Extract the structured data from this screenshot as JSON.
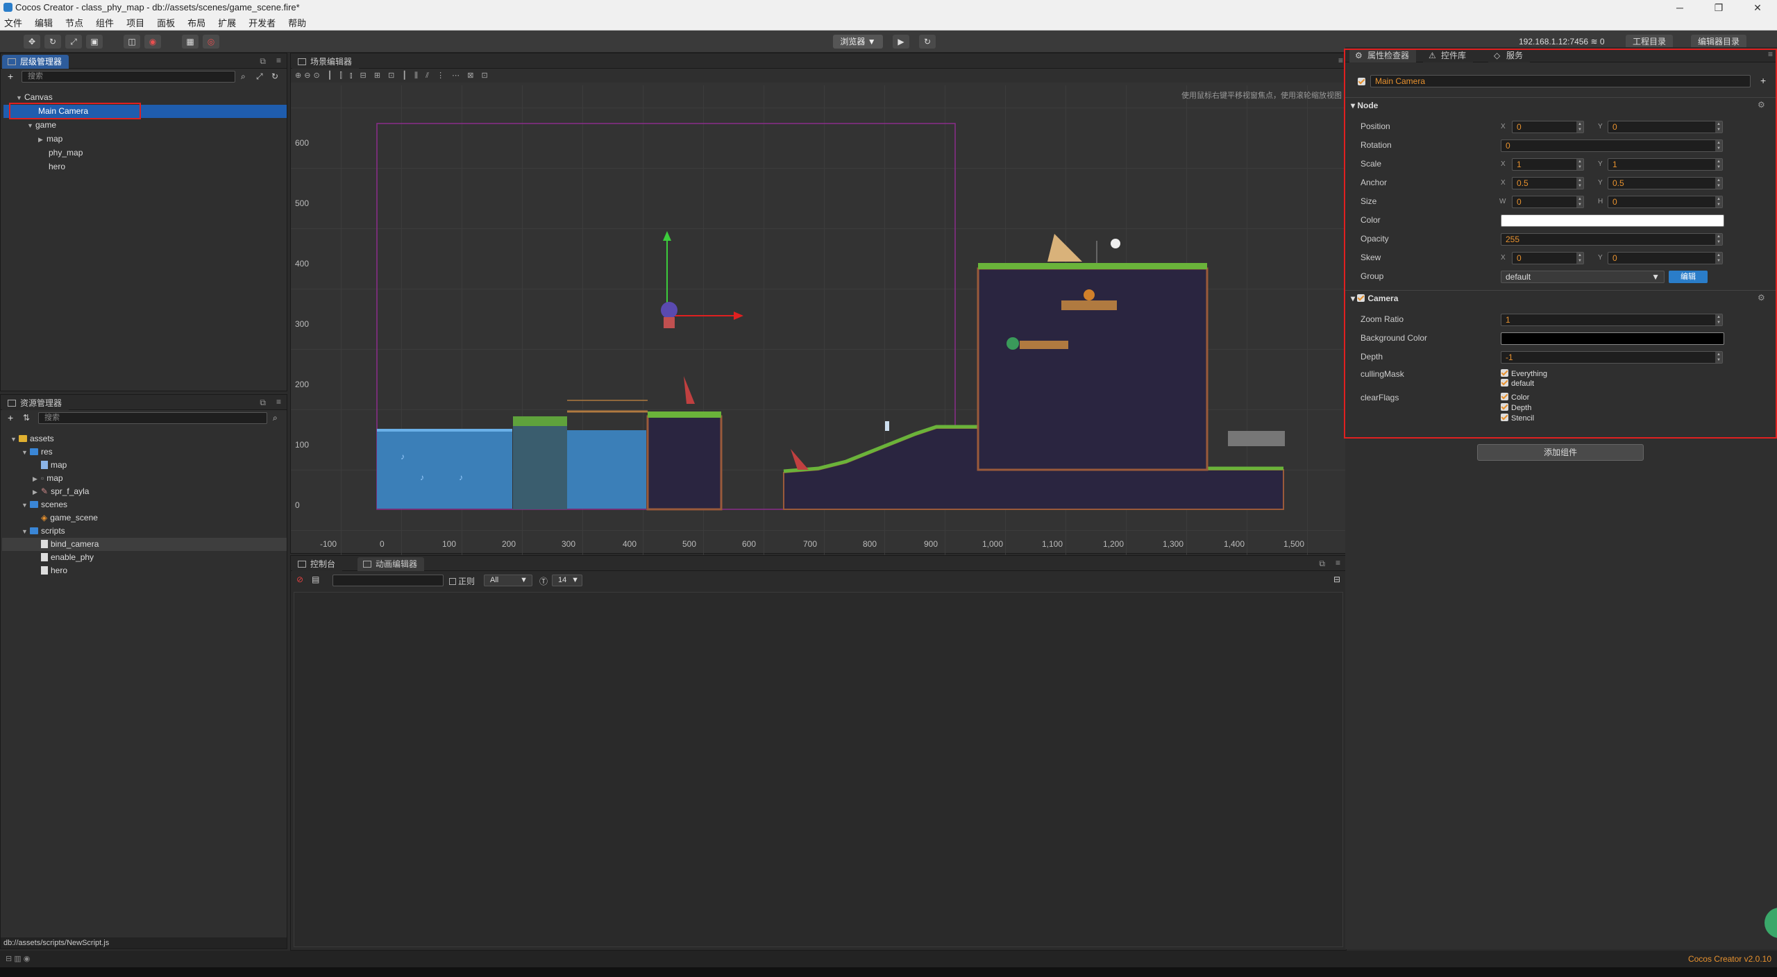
{
  "window": {
    "title": "Cocos Creator - class_phy_map - db://assets/scenes/game_scene.fire*"
  },
  "menu": [
    "文件",
    "编辑",
    "节点",
    "组件",
    "项目",
    "面板",
    "布局",
    "扩展",
    "开发者",
    "帮助"
  ],
  "toolbar": {
    "preview_label": "浏览器 ▼",
    "ip": "192.168.1.12:7456",
    "wifi_count": "0",
    "project_dir": "工程目录",
    "editor_dir": "编辑器目录"
  },
  "hierarchy": {
    "tab": "层级管理器",
    "search_placeholder": "搜索",
    "items": [
      {
        "label": "Canvas"
      },
      {
        "label": "Main Camera"
      },
      {
        "label": "game"
      },
      {
        "label": "map"
      },
      {
        "label": "phy_map"
      },
      {
        "label": "hero"
      }
    ]
  },
  "assets": {
    "tab": "资源管理器",
    "search_placeholder": "搜索",
    "items": [
      {
        "label": "assets"
      },
      {
        "label": "res"
      },
      {
        "label": "map"
      },
      {
        "label": "map"
      },
      {
        "label": "spr_f_ayla"
      },
      {
        "label": "scenes"
      },
      {
        "label": "game_scene"
      },
      {
        "label": "scripts"
      },
      {
        "label": "bind_camera"
      },
      {
        "label": "enable_phy"
      },
      {
        "label": "hero"
      }
    ],
    "status": "db://assets/scripts/NewScript.js"
  },
  "scene": {
    "tab": "场景编辑器",
    "hint": "使用鼠标右键平移视窗焦点，使用滚轮缩放视图",
    "y_ticks": [
      "600",
      "500",
      "400",
      "300",
      "200",
      "100",
      "0"
    ],
    "x_ticks": [
      "-100",
      "0",
      "100",
      "200",
      "300",
      "400",
      "500",
      "600",
      "700",
      "800",
      "900",
      "1,000",
      "1,100",
      "1,200",
      "1,300",
      "1,400",
      "1,500"
    ]
  },
  "console": {
    "tab1": "控制台",
    "tab2": "动画编辑器",
    "regex_label": "正则",
    "level": "All",
    "font_size": "14"
  },
  "inspector": {
    "tabs": [
      "属性检查器",
      "控件库",
      "服务"
    ],
    "node_name": "Main Camera",
    "node_section": "Node",
    "position": {
      "label": "Position",
      "x": "0",
      "y": "0"
    },
    "rotation": {
      "label": "Rotation",
      "value": "0"
    },
    "scale": {
      "label": "Scale",
      "x": "1",
      "y": "1"
    },
    "anchor": {
      "label": "Anchor",
      "x": "0.5",
      "y": "0.5"
    },
    "size": {
      "label": "Size",
      "w": "0",
      "h": "0"
    },
    "color": {
      "label": "Color",
      "value": "#ffffff"
    },
    "opacity": {
      "label": "Opacity",
      "value": "255"
    },
    "skew": {
      "label": "Skew",
      "x": "0",
      "y": "0"
    },
    "group": {
      "label": "Group",
      "value": "default",
      "edit": "编辑"
    },
    "camera_section": "Camera",
    "zoom": {
      "label": "Zoom Ratio",
      "value": "1"
    },
    "bg": {
      "label": "Background Color",
      "value": "#000000"
    },
    "depth": {
      "label": "Depth",
      "value": "-1"
    },
    "culling": {
      "label": "cullingMask",
      "options": [
        "Everything",
        "default"
      ]
    },
    "clear": {
      "label": "clearFlags",
      "options": [
        "Color",
        "Depth",
        "Stencil"
      ]
    },
    "add_component": "添加组件"
  },
  "footer": {
    "version": "Cocos Creator v2.0.10"
  }
}
